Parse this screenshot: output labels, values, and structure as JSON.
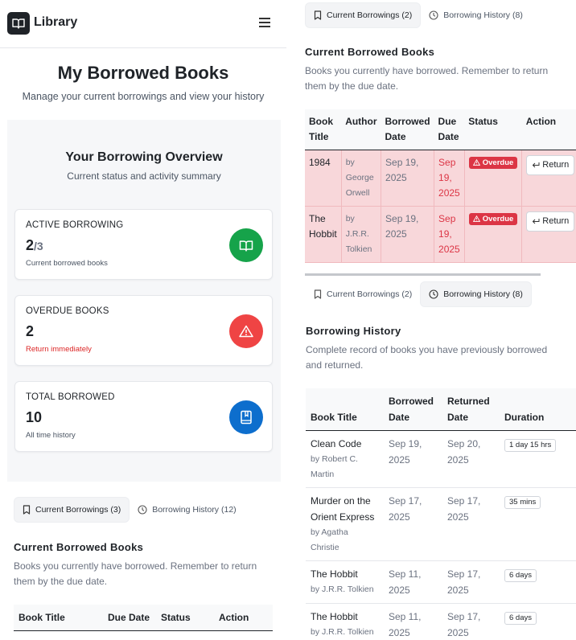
{
  "app": {
    "brand": "Library"
  },
  "page": {
    "title": "My Borrowed Books",
    "subtitle": "Manage your current borrowings and view your history"
  },
  "overview": {
    "title": "Your Borrowing Overview",
    "subtitle": "Current status and activity summary",
    "cards": [
      {
        "label": "ACTIVE BORROWING",
        "value": "2",
        "value_suffix": "/3",
        "note": "Current borrowed books",
        "icon": "open-book-icon",
        "color": "#16a34a"
      },
      {
        "label": "OVERDUE BOOKS",
        "value": "2",
        "note": "Return immediately",
        "icon": "warning-triangle-icon",
        "color": "#ef4444"
      },
      {
        "label": "TOTAL BORROWED",
        "value": "10",
        "note": "All time history",
        "icon": "notebook-icon",
        "color": "#0d6ecd"
      }
    ]
  },
  "left_tabs": {
    "current": "Current Borrowings (3)",
    "history": "Borrowing History (12)"
  },
  "left_current": {
    "title": "Current Borrowed Books",
    "desc": "Books you currently have borrowed. Remember to return them by the due date.",
    "columns": [
      "Book Title",
      "Due Date",
      "Status",
      "Action"
    ]
  },
  "right_tabs_top": {
    "current": "Current Borrowings (2)",
    "history": "Borrowing History (8)"
  },
  "right_current": {
    "title": "Current Borrowed Books",
    "desc": "Books you currently have borrowed. Remember to return them by the due date.",
    "columns": [
      "Book Title",
      "Author",
      "Borrowed Date",
      "Due Date",
      "Status",
      "Action"
    ],
    "rows": [
      {
        "title": "1984",
        "author": "by George Orwell",
        "borrowed": "Sep 19, 2025",
        "due": "Sep 19, 2025",
        "status": "Overdue",
        "action": "Return"
      },
      {
        "title": "The Hobbit",
        "author": "by J.R.R. Tolkien",
        "borrowed": "Sep 19, 2025",
        "due": "Sep 19, 2025",
        "status": "Overdue",
        "action": "Return"
      }
    ]
  },
  "right_tabs_mid": {
    "current": "Current Borrowings (2)",
    "history": "Borrowing History (8)"
  },
  "history": {
    "title": "Borrowing History",
    "desc": "Complete record of books you have previously borrowed and returned.",
    "columns": [
      "Book Title",
      "Borrowed Date",
      "Returned Date",
      "Duration"
    ],
    "rows": [
      {
        "title": "Clean Code",
        "author": "by Robert C. Martin",
        "borrowed": "Sep 19, 2025",
        "returned": "Sep 20, 2025",
        "duration": "1 day 15 hrs"
      },
      {
        "title": "Murder on the Orient Express",
        "author": "by Agatha Christie",
        "borrowed": "Sep 17, 2025",
        "returned": "Sep 17, 2025",
        "duration": "35 mins"
      },
      {
        "title": "The Hobbit",
        "author": "by J.R.R. Tolkien",
        "borrowed": "Sep 11, 2025",
        "returned": "Sep 17, 2025",
        "duration": "6 days"
      },
      {
        "title": "The Hobbit",
        "author": "by J.R.R. Tolkien",
        "borrowed": "Sep 11, 2025",
        "returned": "Sep 17, 2025",
        "duration": "6 days"
      }
    ]
  }
}
